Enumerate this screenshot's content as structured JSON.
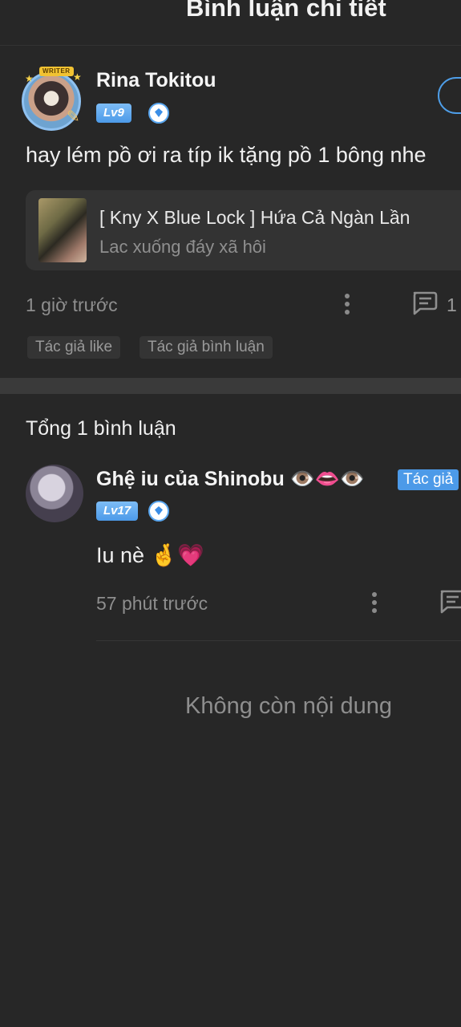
{
  "header": {
    "title": "Bình luận chi tiết"
  },
  "main_comment": {
    "avatar_badge": "WRITER",
    "username": "Rina Tokitou",
    "level": "Lv9",
    "text": "hay lém pồ ơi ra típ ik tặng pồ 1 bông nhe",
    "work": {
      "title": "[ Kny X Blue Lock ] Hứa Cả Ngàn Lần",
      "author": "Lac xuống đáy xã hôi"
    },
    "time": "1 giờ trước",
    "reply_count": "1",
    "tags": [
      "Tác giả like",
      "Tác giả bình luận"
    ]
  },
  "replies": {
    "total_label": "Tổng 1 bình luận",
    "items": [
      {
        "username": "Ghệ iu của Shinobu 👁️👄👁️",
        "author_badge": "Tác giả",
        "level": "Lv17",
        "text": "Iu nè 🤞💗",
        "time": "57 phút trước"
      }
    ]
  },
  "footer": {
    "end_text": "Không còn nội dung"
  },
  "colors": {
    "background": "#272727",
    "accent": "#4c9ae8",
    "muted": "#8e8e8e"
  },
  "icons": [
    "more-vertical-icon",
    "comment-icon",
    "vip-diamond-icon"
  ]
}
